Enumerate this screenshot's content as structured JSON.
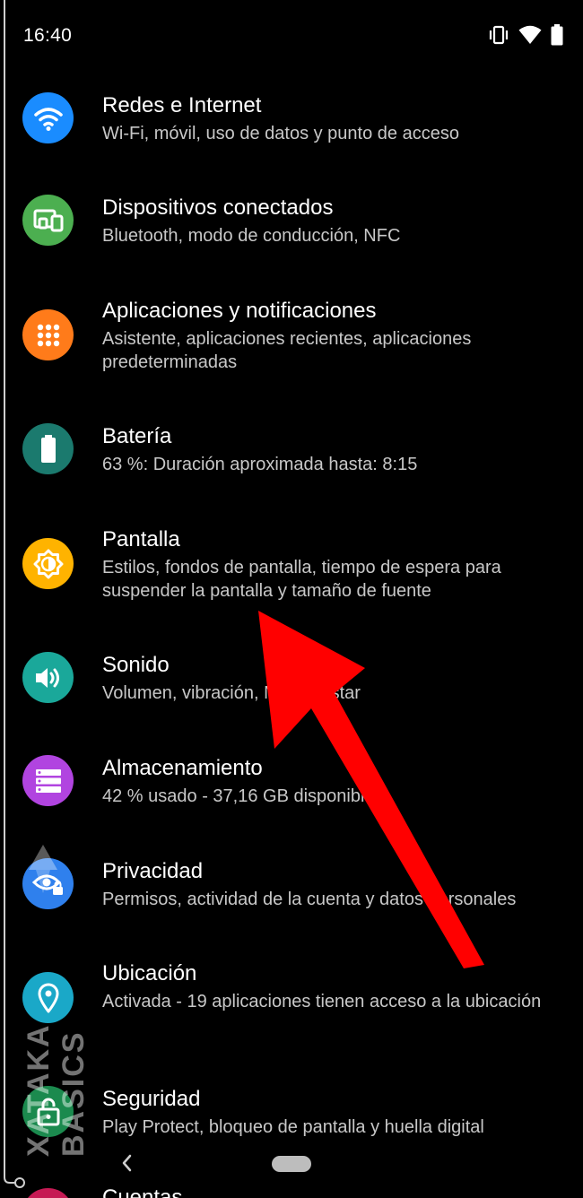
{
  "status_bar": {
    "time": "16:40",
    "icons": [
      "vibrate-icon",
      "wifi-icon",
      "battery-icon"
    ]
  },
  "settings": [
    {
      "title": "Redes e Internet",
      "subtitle": "Wi-Fi, móvil, uso de datos y punto de acceso",
      "icon": "wifi-icon",
      "color": "#1a8cff"
    },
    {
      "title": "Dispositivos conectados",
      "subtitle": "Bluetooth, modo de conducción, NFC",
      "icon": "devices-icon",
      "color": "#4caf50"
    },
    {
      "title": "Aplicaciones y notificaciones",
      "subtitle": "Asistente, aplicaciones recientes, aplicaciones predeterminadas",
      "icon": "apps-grid-icon",
      "color": "#ff7b1a"
    },
    {
      "title": "Batería",
      "subtitle": "63 %: Duración aproximada hasta: 8:15",
      "icon": "battery-icon",
      "color": "#1b7a6e"
    },
    {
      "title": "Pantalla",
      "subtitle": "Estilos, fondos de pantalla, tiempo de espera para suspender la pantalla y tamaño de fuente",
      "icon": "brightness-icon",
      "color": "#ffb300"
    },
    {
      "title": "Sonido",
      "subtitle": "Volumen, vibración, No molestar",
      "icon": "volume-icon",
      "color": "#1aa89a"
    },
    {
      "title": "Almacenamiento",
      "subtitle": "42 % usado - 37,16 GB disponibles",
      "icon": "storage-icon",
      "color": "#b144e0"
    },
    {
      "title": "Privacidad",
      "subtitle": "Permisos, actividad de la cuenta y datos personales",
      "icon": "privacy-eye-icon",
      "color": "#2f80ed"
    },
    {
      "title": "Ubicación",
      "subtitle": "Activada - 19 aplicaciones tienen acceso a la ubicación",
      "icon": "location-pin-icon",
      "color": "#1aa8c8"
    },
    {
      "title": "Seguridad",
      "subtitle": "Play Protect, bloqueo de pantalla y huella digital",
      "icon": "lock-icon",
      "color": "#1b8a4e"
    }
  ],
  "peek_item": {
    "title": "Cuentas"
  },
  "watermark": "XATAKA BASICS",
  "annotation": {
    "type": "arrow",
    "color": "#ff0000",
    "points_to": "Pantalla"
  },
  "navigation": {
    "back": "back-icon",
    "home": "home-pill"
  }
}
